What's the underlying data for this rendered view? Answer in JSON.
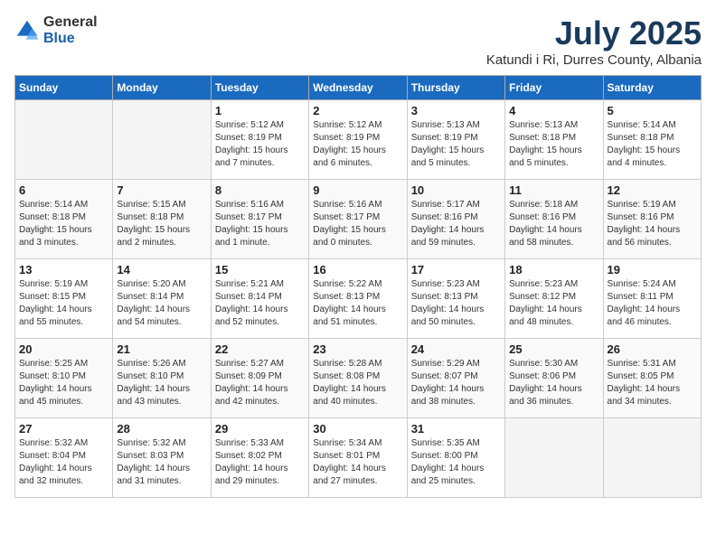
{
  "header": {
    "logo_general": "General",
    "logo_blue": "Blue",
    "month": "July 2025",
    "location": "Katundi i Ri, Durres County, Albania"
  },
  "weekdays": [
    "Sunday",
    "Monday",
    "Tuesday",
    "Wednesday",
    "Thursday",
    "Friday",
    "Saturday"
  ],
  "weeks": [
    [
      {
        "day": "",
        "info": ""
      },
      {
        "day": "",
        "info": ""
      },
      {
        "day": "1",
        "info": "Sunrise: 5:12 AM\nSunset: 8:19 PM\nDaylight: 15 hours\nand 7 minutes."
      },
      {
        "day": "2",
        "info": "Sunrise: 5:12 AM\nSunset: 8:19 PM\nDaylight: 15 hours\nand 6 minutes."
      },
      {
        "day": "3",
        "info": "Sunrise: 5:13 AM\nSunset: 8:19 PM\nDaylight: 15 hours\nand 5 minutes."
      },
      {
        "day": "4",
        "info": "Sunrise: 5:13 AM\nSunset: 8:18 PM\nDaylight: 15 hours\nand 5 minutes."
      },
      {
        "day": "5",
        "info": "Sunrise: 5:14 AM\nSunset: 8:18 PM\nDaylight: 15 hours\nand 4 minutes."
      }
    ],
    [
      {
        "day": "6",
        "info": "Sunrise: 5:14 AM\nSunset: 8:18 PM\nDaylight: 15 hours\nand 3 minutes."
      },
      {
        "day": "7",
        "info": "Sunrise: 5:15 AM\nSunset: 8:18 PM\nDaylight: 15 hours\nand 2 minutes."
      },
      {
        "day": "8",
        "info": "Sunrise: 5:16 AM\nSunset: 8:17 PM\nDaylight: 15 hours\nand 1 minute."
      },
      {
        "day": "9",
        "info": "Sunrise: 5:16 AM\nSunset: 8:17 PM\nDaylight: 15 hours\nand 0 minutes."
      },
      {
        "day": "10",
        "info": "Sunrise: 5:17 AM\nSunset: 8:16 PM\nDaylight: 14 hours\nand 59 minutes."
      },
      {
        "day": "11",
        "info": "Sunrise: 5:18 AM\nSunset: 8:16 PM\nDaylight: 14 hours\nand 58 minutes."
      },
      {
        "day": "12",
        "info": "Sunrise: 5:19 AM\nSunset: 8:16 PM\nDaylight: 14 hours\nand 56 minutes."
      }
    ],
    [
      {
        "day": "13",
        "info": "Sunrise: 5:19 AM\nSunset: 8:15 PM\nDaylight: 14 hours\nand 55 minutes."
      },
      {
        "day": "14",
        "info": "Sunrise: 5:20 AM\nSunset: 8:14 PM\nDaylight: 14 hours\nand 54 minutes."
      },
      {
        "day": "15",
        "info": "Sunrise: 5:21 AM\nSunset: 8:14 PM\nDaylight: 14 hours\nand 52 minutes."
      },
      {
        "day": "16",
        "info": "Sunrise: 5:22 AM\nSunset: 8:13 PM\nDaylight: 14 hours\nand 51 minutes."
      },
      {
        "day": "17",
        "info": "Sunrise: 5:23 AM\nSunset: 8:13 PM\nDaylight: 14 hours\nand 50 minutes."
      },
      {
        "day": "18",
        "info": "Sunrise: 5:23 AM\nSunset: 8:12 PM\nDaylight: 14 hours\nand 48 minutes."
      },
      {
        "day": "19",
        "info": "Sunrise: 5:24 AM\nSunset: 8:11 PM\nDaylight: 14 hours\nand 46 minutes."
      }
    ],
    [
      {
        "day": "20",
        "info": "Sunrise: 5:25 AM\nSunset: 8:10 PM\nDaylight: 14 hours\nand 45 minutes."
      },
      {
        "day": "21",
        "info": "Sunrise: 5:26 AM\nSunset: 8:10 PM\nDaylight: 14 hours\nand 43 minutes."
      },
      {
        "day": "22",
        "info": "Sunrise: 5:27 AM\nSunset: 8:09 PM\nDaylight: 14 hours\nand 42 minutes."
      },
      {
        "day": "23",
        "info": "Sunrise: 5:28 AM\nSunset: 8:08 PM\nDaylight: 14 hours\nand 40 minutes."
      },
      {
        "day": "24",
        "info": "Sunrise: 5:29 AM\nSunset: 8:07 PM\nDaylight: 14 hours\nand 38 minutes."
      },
      {
        "day": "25",
        "info": "Sunrise: 5:30 AM\nSunset: 8:06 PM\nDaylight: 14 hours\nand 36 minutes."
      },
      {
        "day": "26",
        "info": "Sunrise: 5:31 AM\nSunset: 8:05 PM\nDaylight: 14 hours\nand 34 minutes."
      }
    ],
    [
      {
        "day": "27",
        "info": "Sunrise: 5:32 AM\nSunset: 8:04 PM\nDaylight: 14 hours\nand 32 minutes."
      },
      {
        "day": "28",
        "info": "Sunrise: 5:32 AM\nSunset: 8:03 PM\nDaylight: 14 hours\nand 31 minutes."
      },
      {
        "day": "29",
        "info": "Sunrise: 5:33 AM\nSunset: 8:02 PM\nDaylight: 14 hours\nand 29 minutes."
      },
      {
        "day": "30",
        "info": "Sunrise: 5:34 AM\nSunset: 8:01 PM\nDaylight: 14 hours\nand 27 minutes."
      },
      {
        "day": "31",
        "info": "Sunrise: 5:35 AM\nSunset: 8:00 PM\nDaylight: 14 hours\nand 25 minutes."
      },
      {
        "day": "",
        "info": ""
      },
      {
        "day": "",
        "info": ""
      }
    ]
  ]
}
